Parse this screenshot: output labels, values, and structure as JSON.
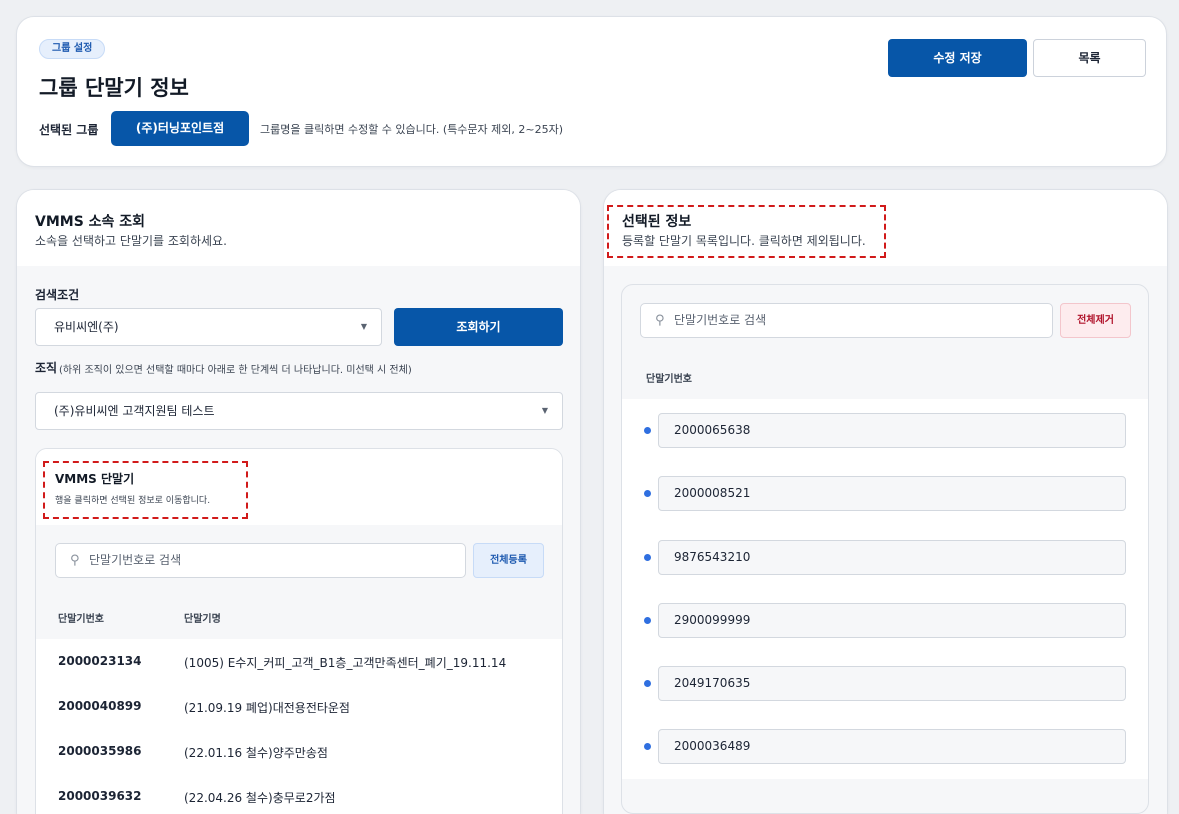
{
  "header": {
    "badge": "그룹 설정",
    "title": "그룹 단말기 정보",
    "selected_group_label": "선택된 그룹",
    "selected_group_name": "(주)터닝포인트점",
    "group_hint": "그룹명을 클릭하면 수정할 수 있습니다. (특수문자 제외, 2~25자)",
    "save_label": "수정 저장",
    "list_label": "목록"
  },
  "left_panel": {
    "title": "VMMS 소속 조회",
    "subtitle": "소속을 선택하고 단말기를 조회하세요.",
    "condition_label": "검색조건",
    "condition_value": "유비씨엔(주)",
    "search_button": "조회하기",
    "org_label": "조직",
    "org_hint": "(하위 조직이 있으면 선택할 때마다 아래로 한 단계씩 더 나타납니다. 미선택 시 전체)",
    "org_value": "(주)유비씨엔 고객지원팀 테스트",
    "terminal_box": {
      "title": "VMMS 단말기",
      "subtitle": "행을 클릭하면 선택된 정보로 이동합니다.",
      "search_placeholder": "단말기번호로 검색",
      "register_all": "전체등록",
      "columns": [
        "단말기번호",
        "단말기명"
      ],
      "rows": [
        {
          "number": "2000023134",
          "name": "(1005) E수지_커피_고객_B1층_고객만족센터_폐기_19.11.14"
        },
        {
          "number": "2000040899",
          "name": "(21.09.19 폐업)대전용전타운점"
        },
        {
          "number": "2000035986",
          "name": "(22.01.16 철수)양주만송점"
        },
        {
          "number": "2000039632",
          "name": "(22.04.26 철수)충무로2가점"
        }
      ]
    }
  },
  "right_panel": {
    "title": "선택된 정보",
    "subtitle": "등록할 단말기 목록입니다. 클릭하면 제외됩니다.",
    "search_placeholder": "단말기번호로 검색",
    "clear_all": "전체제거",
    "column": "단말기번호",
    "items": [
      "2000065638",
      "2000008521",
      "9876543210",
      "2900099999",
      "2049170635",
      "2000036489"
    ]
  },
  "icons": {
    "search": "search-icon",
    "dropdown": "caret-down-icon"
  },
  "colors": {
    "primary": "#0756a8",
    "accent_red": "#d11a1a",
    "bullet": "#2f6fe0"
  }
}
